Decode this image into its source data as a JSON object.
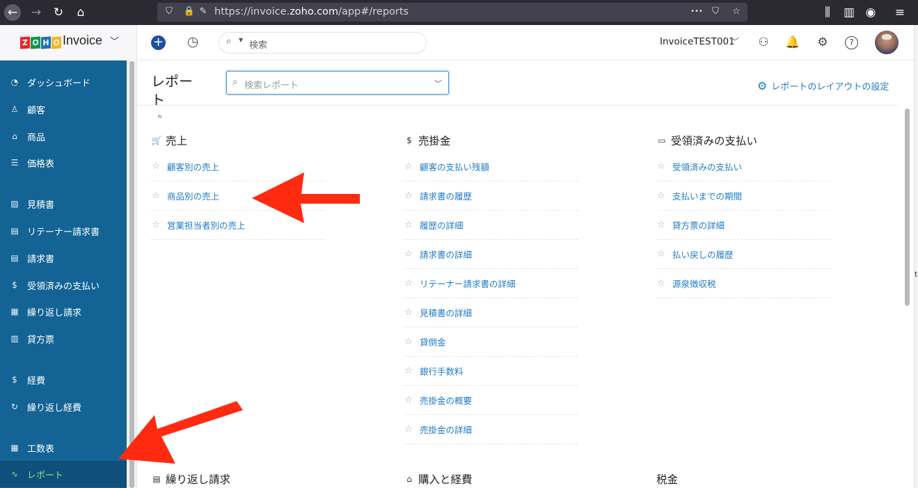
{
  "browser": {
    "url_prefix": "https://invoice.",
    "url_domain": "zoho.com",
    "url_path": "/app#/reports",
    "more_label": "•••"
  },
  "header": {
    "brand_letters": [
      "Z",
      "O",
      "H",
      "O"
    ],
    "brand_colors": [
      "#e42527",
      "#089949",
      "#226db4",
      "#f9b21d"
    ],
    "brand_name": "Invoice",
    "search_placeholder": "検索",
    "org_name": "InvoiceTEST001"
  },
  "sidebar": {
    "items": [
      {
        "label": "ダッシュボード",
        "icon": "dashboard-icon",
        "glyph": "◔"
      },
      {
        "label": "顧客",
        "icon": "customer-icon",
        "glyph": "♙"
      },
      {
        "label": "商品",
        "icon": "items-icon",
        "glyph": "⌂"
      },
      {
        "label": "価格表",
        "icon": "price-list-icon",
        "glyph": "☰"
      },
      {
        "label": "見積書",
        "icon": "estimate-icon",
        "glyph": "▨"
      },
      {
        "label": "リテーナー請求書",
        "icon": "retainer-invoice-icon",
        "glyph": "▤"
      },
      {
        "label": "請求書",
        "icon": "invoice-icon",
        "glyph": "▤"
      },
      {
        "label": "受領済みの支払い",
        "icon": "payment-received-icon",
        "glyph": "$"
      },
      {
        "label": "繰り返し請求",
        "icon": "recurring-invoice-icon",
        "glyph": "▦"
      },
      {
        "label": "貸方票",
        "icon": "credit-note-icon",
        "glyph": "▥"
      },
      {
        "label": "経費",
        "icon": "expense-icon",
        "glyph": "$"
      },
      {
        "label": "繰り返し経費",
        "icon": "recurring-expense-icon",
        "glyph": "↻"
      },
      {
        "label": "工数表",
        "icon": "timesheet-icon",
        "glyph": "▦"
      },
      {
        "label": "レポート",
        "icon": "reports-icon",
        "glyph": "∿"
      }
    ]
  },
  "main": {
    "title": "レポート",
    "report_search_placeholder": "検索レポート",
    "layout_link": "レポートのレイアウトの設定",
    "sections": [
      {
        "title": "売上",
        "icon": "cart-icon",
        "glyph": "🛒",
        "items": [
          "顧客別の売上",
          "商品別の売上",
          "営業担当者別の売上"
        ]
      },
      {
        "title": "売掛金",
        "icon": "receivable-icon",
        "glyph": "$",
        "items": [
          "顧客の支払い残額",
          "請求書の履歴",
          "履歴の詳細",
          "請求書の詳細",
          "リテーナー請求書の詳細",
          "見積書の詳細",
          "貸倒金",
          "銀行手数料",
          "売掛金の概要",
          "売掛金の詳細"
        ]
      },
      {
        "title": "受領済みの支払い",
        "icon": "payment-card-icon",
        "glyph": "▭",
        "items": [
          "受領済みの支払い",
          "支払いまでの期間",
          "貸方票の詳細",
          "払い戻しの履歴",
          "源泉徴収税"
        ]
      },
      {
        "title": "繰り返し請求",
        "icon": "recurring-doc-icon",
        "glyph": "▤",
        "items": []
      },
      {
        "title": "購入と経費",
        "icon": "bag-icon",
        "glyph": "⌂",
        "items": []
      },
      {
        "title": "税金",
        "icon": "",
        "glyph": "",
        "items": []
      }
    ]
  },
  "annotation_color": "#ff2a10",
  "accent_blue": "#1f7ac6",
  "sidebar_color": "#136395",
  "active_color": "#8ee08e"
}
